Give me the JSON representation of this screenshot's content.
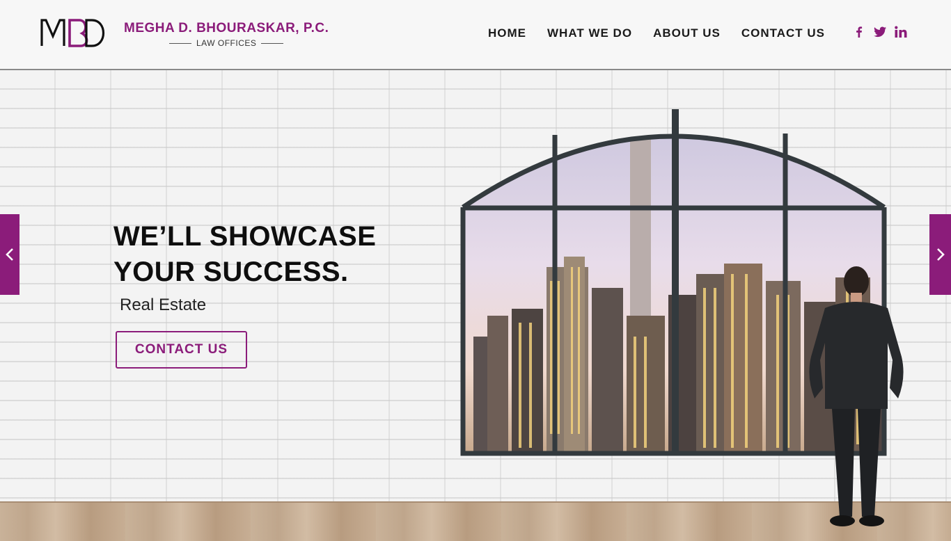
{
  "header": {
    "logo_initials": "MBD",
    "firm_name": "MEGHA D. BHOURASKAR, P.C.",
    "firm_sub": "LAW OFFICES",
    "nav": [
      {
        "label": "HOME"
      },
      {
        "label": "WHAT WE DO"
      },
      {
        "label": "ABOUT US"
      },
      {
        "label": "CONTACT US"
      }
    ],
    "social": [
      "facebook-icon",
      "twitter-icon",
      "linkedin-icon"
    ]
  },
  "hero": {
    "headline_line1": "WE’LL SHOWCASE",
    "headline_line2": "YOUR SUCCESS.",
    "subline": "Real Estate",
    "cta_label": "CONTACT US",
    "prev_icon": "chevron-left-icon",
    "next_icon": "chevron-right-icon"
  },
  "colors": {
    "brand": "#8b1c7a",
    "text": "#0e0e0e",
    "header_bg": "#f7f7f7"
  }
}
